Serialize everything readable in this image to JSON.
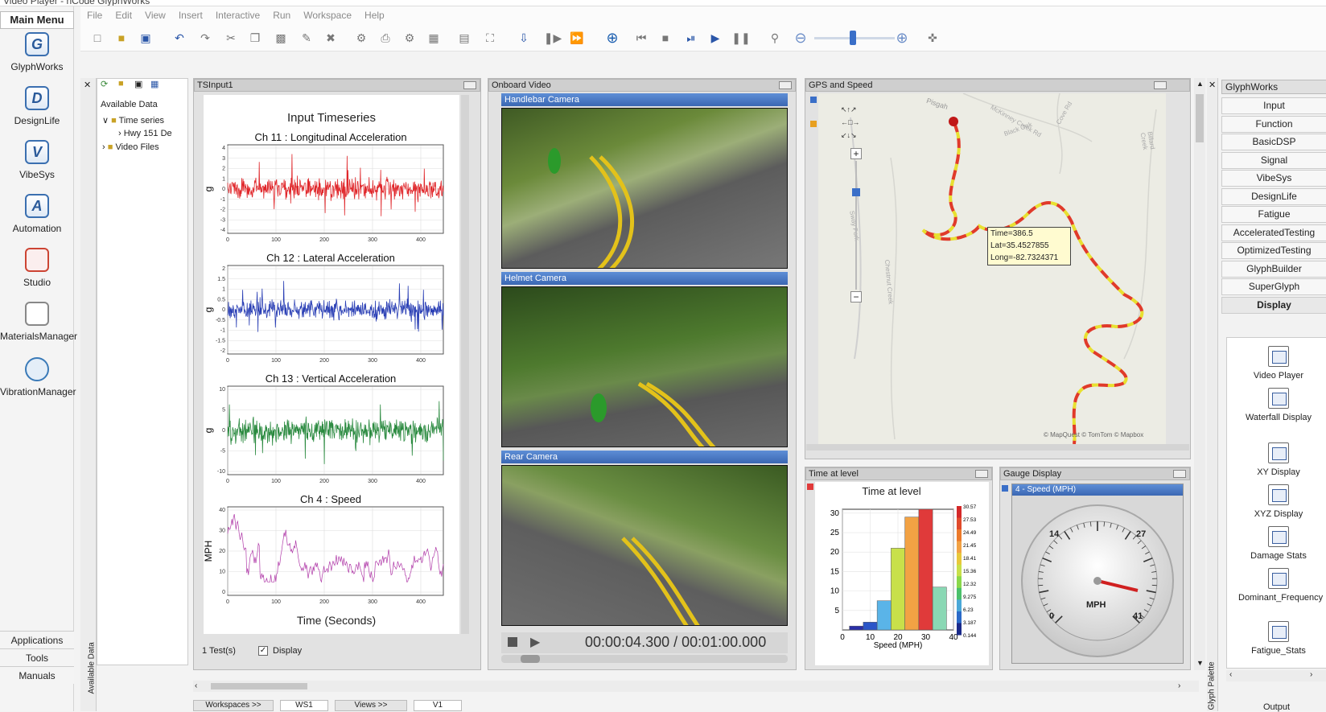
{
  "window": {
    "title": "Video Player - nCode GlyphWorks"
  },
  "menu": [
    "File",
    "Edit",
    "View",
    "Insert",
    "Interactive",
    "Run",
    "Workspace",
    "Help"
  ],
  "leftnav": {
    "main_menu": "Main Menu",
    "apps": [
      {
        "label": "GlyphWorks",
        "letter": "G"
      },
      {
        "label": "DesignLife",
        "letter": "D"
      },
      {
        "label": "VibeSys",
        "letter": "V"
      },
      {
        "label": "Automation",
        "letter": "A"
      },
      {
        "label": "Studio",
        "letter": ""
      },
      {
        "label": "MaterialsManager",
        "letter": ""
      },
      {
        "label": "VibrationManager",
        "letter": ""
      }
    ],
    "applications": "Applications",
    "tools": "Tools",
    "manuals": "Manuals"
  },
  "datapanel": {
    "title": "Available Data",
    "tree": [
      "Time series",
      "Hwy 151 De",
      "Video Files"
    ],
    "vertical_label": "Available Data"
  },
  "tsinput": {
    "header": "TSInput1",
    "title": "Input Timeseries",
    "footer_tests": "1 Test(s)",
    "footer_display": "Display",
    "xlabel": "Time (Seconds)",
    "channels": [
      {
        "title": "Ch 11 : Longitudinal Acceleration",
        "unit": "g",
        "color": "#e0262a",
        "ticks": [
          "4",
          "3",
          "2",
          "1",
          "0",
          "-1",
          "-2",
          "-3",
          "-4"
        ]
      },
      {
        "title": "Ch 12 : Lateral Acceleration",
        "unit": "g",
        "color": "#2a3fb5",
        "ticks": [
          "2",
          "1.5",
          "1",
          "0.5",
          "0",
          "-0.5",
          "-1",
          "-1.5",
          "-2"
        ]
      },
      {
        "title": "Ch 13 : Vertical Acceleration",
        "unit": "g",
        "color": "#2a8a3f",
        "ticks": [
          "10",
          "5",
          "0",
          "-5",
          "-10"
        ]
      },
      {
        "title": "Ch 4 : Speed",
        "unit": "MPH",
        "color": "#b03aa8",
        "ticks": [
          "40",
          "30",
          "20",
          "10",
          "0"
        ]
      }
    ],
    "xticks": [
      "0",
      "100",
      "200",
      "300",
      "400"
    ]
  },
  "video": {
    "header": "Onboard Video",
    "cameras": [
      "Handlebar Camera",
      "Helmet Camera",
      "Rear Camera"
    ],
    "timecode": "00:00:04.300 / 00:01:00.000"
  },
  "gps": {
    "header": "GPS and Speed",
    "tooltip": [
      "Time=386.5",
      "Lat=35.4527855",
      "Long=-82.7324371"
    ],
    "places": [
      "Pisgah",
      "McKinney Creek Rd",
      "Black Oak",
      "Cove Rd",
      "Sway Fork",
      "Chestnut Creek",
      "Billard Creek"
    ],
    "attribution": "© MapQuest © TomTom © Mapbox"
  },
  "timelevel": {
    "header": "Time at level",
    "title": "Time at level",
    "xlabel": "Speed (MPH)",
    "colorbar": [
      "30.57",
      "27.53",
      "24.49",
      "21.45",
      "18.41",
      "15.36",
      "12.32",
      "9.275",
      "6.23",
      "3.187",
      "0.144"
    ]
  },
  "gauge": {
    "header": "Gauge Display",
    "channel": "4 - Speed (MPH)",
    "labels": [
      "0",
      "14",
      "27",
      "41"
    ],
    "unit": "MPH"
  },
  "palette": {
    "header": "GlyphWorks",
    "vertical_label": "Glyph Palette",
    "buttons": [
      "Input",
      "Function",
      "BasicDSP",
      "Signal",
      "VibeSys",
      "DesignLife",
      "Fatigue",
      "AcceleratedTesting",
      "OptimizedTesting",
      "GlyphBuilder",
      "SuperGlyph",
      "Display"
    ],
    "glyphs": [
      "Video Player",
      "Waterfall Display",
      "XY Display",
      "XYZ Display",
      "Damage Stats",
      "Dominant_Frequency",
      "Fatigue_Stats"
    ],
    "output": "Output"
  },
  "bottomtabs": [
    "Workspaces >>",
    "WS1",
    "Views >>",
    "V1"
  ],
  "chart_data": [
    {
      "type": "bar",
      "title": "Time at level",
      "xlabel": "Speed (MPH)",
      "ylabel": "",
      "categories": [
        "5",
        "10",
        "15",
        "20",
        "25",
        "30",
        "35"
      ],
      "values": [
        1,
        2,
        7.5,
        21,
        29,
        31,
        11
      ],
      "colors": [
        "#2a2fa8",
        "#2a56c8",
        "#5ab4e8",
        "#c8e04a",
        "#f2a244",
        "#e03a3a",
        "#8ad8b4"
      ],
      "xticks": [
        "0",
        "10",
        "20",
        "30",
        "40"
      ],
      "yticks": [
        "5",
        "10",
        "15",
        "20",
        "25",
        "30"
      ],
      "xlim": [
        0,
        40
      ],
      "ylim": [
        0,
        31
      ]
    },
    {
      "type": "line",
      "title": "Ch 4 : Speed",
      "xlabel": "Time (Seconds)",
      "ylabel": "MPH",
      "xlim": [
        0,
        470
      ],
      "ylim": [
        0,
        40
      ]
    }
  ]
}
